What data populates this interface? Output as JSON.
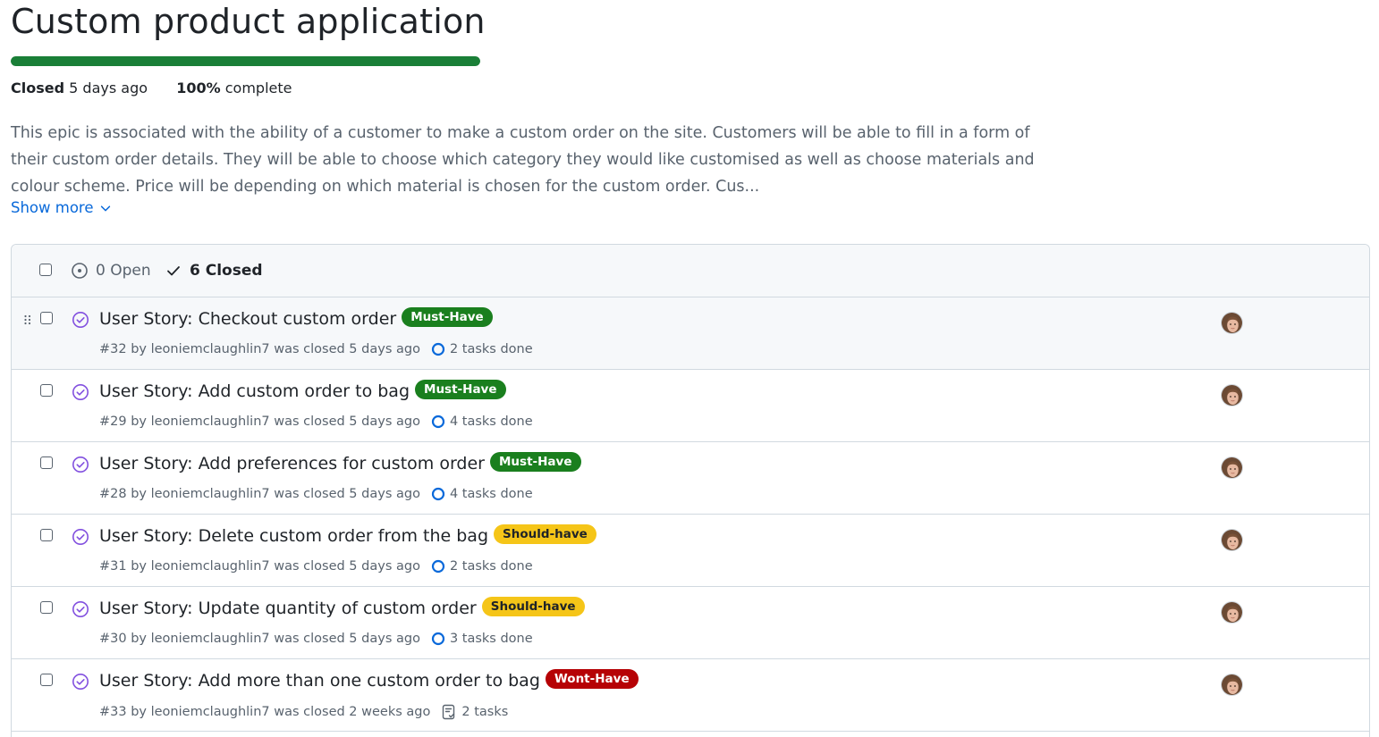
{
  "epic": {
    "title": "Custom product application",
    "progress_percent": 100,
    "status": "Closed",
    "status_time": "5 days ago",
    "complete_value": "100%",
    "complete_label": "complete",
    "description": "This epic is associated with the ability of a customer to make a custom order on the site. Customers will be able to fill in a form of their custom order details. They will be able to choose which category they would like customised as well as choose materials and colour scheme. Price will be depending on which material is chosen for the custom order. Cus...",
    "show_more": "Show more"
  },
  "list_header": {
    "open_label": "0 Open",
    "closed_label": "6 Closed"
  },
  "colors": {
    "progress": "#1a7f37",
    "closed_state": "#8250df",
    "link": "#0969da",
    "progress_ring": "#0969da"
  },
  "issues": [
    {
      "title": "User Story: Checkout custom order",
      "label": "Must-Have",
      "label_bg": "#1a7f1e",
      "label_fg": "#ffffff",
      "meta": "#32 by leoniemclaughlin7 was closed 5 days ago",
      "tasks": "2 tasks done",
      "tasks_icon": "progress-ring-icon"
    },
    {
      "title": "User Story: Add custom order to bag",
      "label": "Must-Have",
      "label_bg": "#1a7f1e",
      "label_fg": "#ffffff",
      "meta": "#29 by leoniemclaughlin7 was closed 5 days ago",
      "tasks": "4 tasks done",
      "tasks_icon": "progress-ring-icon"
    },
    {
      "title": "User Story: Add preferences for custom order",
      "label": "Must-Have",
      "label_bg": "#1a7f1e",
      "label_fg": "#ffffff",
      "meta": "#28 by leoniemclaughlin7 was closed 5 days ago",
      "tasks": "4 tasks done",
      "tasks_icon": "progress-ring-icon"
    },
    {
      "title": "User Story: Delete custom order from the bag",
      "label": "Should-have",
      "label_bg": "#f5c518",
      "label_fg": "#1f2328",
      "meta": "#31 by leoniemclaughlin7 was closed 5 days ago",
      "tasks": "2 tasks done",
      "tasks_icon": "progress-ring-icon"
    },
    {
      "title": "User Story: Update quantity of custom order",
      "label": "Should-have",
      "label_bg": "#f5c518",
      "label_fg": "#1f2328",
      "meta": "#30 by leoniemclaughlin7 was closed 5 days ago",
      "tasks": "3 tasks done",
      "tasks_icon": "progress-ring-icon"
    },
    {
      "title": "User Story: Add more than one custom order to bag",
      "label": "Wont-Have",
      "label_bg": "#b60205",
      "label_fg": "#ffffff",
      "meta": "#33 by leoniemclaughlin7 was closed 2 weeks ago",
      "tasks": "2 tasks",
      "tasks_icon": "checklist-icon"
    }
  ]
}
